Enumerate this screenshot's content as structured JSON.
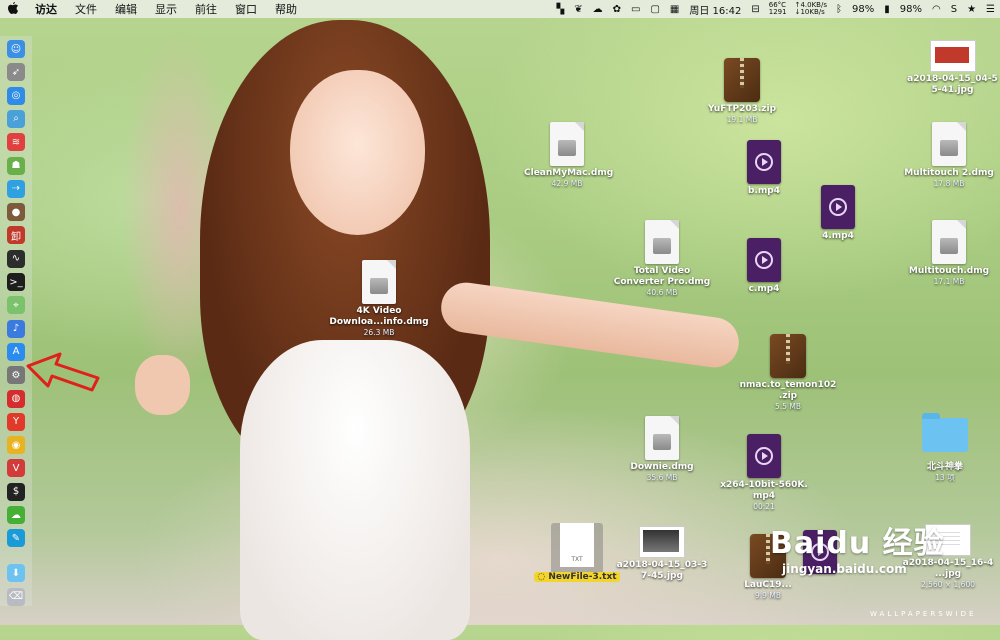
{
  "menubar": {
    "apple": "",
    "items": [
      "访达",
      "文件",
      "编辑",
      "显示",
      "前往",
      "窗口",
      "帮助"
    ],
    "status": {
      "clock": "周日 16:42",
      "temp": "66°C",
      "fan": "1291",
      "upload": "↑4.0KB/s",
      "download": "↓10KB/s",
      "battery1": "98%",
      "battery2": "98%"
    }
  },
  "dock": {
    "icons": [
      {
        "name": "finder-icon",
        "color": "#3b8fe5",
        "glyph": "☺"
      },
      {
        "name": "launchpad-icon",
        "color": "#8a8a8a",
        "glyph": "➶"
      },
      {
        "name": "safari-icon",
        "color": "#2e8ce6",
        "glyph": "◎"
      },
      {
        "name": "preview-icon",
        "color": "#4aa0d8",
        "glyph": "⌕"
      },
      {
        "name": "app-red-icon",
        "color": "#e04040",
        "glyph": "≋"
      },
      {
        "name": "android-icon",
        "color": "#69b04a",
        "glyph": "☗"
      },
      {
        "name": "migration-icon",
        "color": "#2fa0e0",
        "glyph": "⇢"
      },
      {
        "name": "brown-app-icon",
        "color": "#7d5a3b",
        "glyph": "●"
      },
      {
        "name": "red-app-icon",
        "color": "#c0392b",
        "glyph": "卸"
      },
      {
        "name": "activity-monitor-icon",
        "color": "#2d2d2d",
        "glyph": "∿"
      },
      {
        "name": "terminal-icon",
        "color": "#1e1e1e",
        "glyph": ">_"
      },
      {
        "name": "maps-icon",
        "color": "#7cc26d",
        "glyph": "⌖"
      },
      {
        "name": "siri-icon",
        "color": "#3b7be0",
        "glyph": "♪"
      },
      {
        "name": "app-store-icon",
        "color": "#2b8cf0",
        "glyph": "A"
      },
      {
        "name": "system-preferences-icon",
        "color": "#777777",
        "glyph": "⚙"
      },
      {
        "name": "netease-music-icon",
        "color": "#d42d2d",
        "glyph": "◍"
      },
      {
        "name": "yandex-icon",
        "color": "#e23a2a",
        "glyph": "Y"
      },
      {
        "name": "chrome-icon",
        "color": "#e8b320",
        "glyph": "◉"
      },
      {
        "name": "vivaldi-icon",
        "color": "#d33b3b",
        "glyph": "V"
      },
      {
        "name": "console-icon",
        "color": "#222222",
        "glyph": "$"
      },
      {
        "name": "wechat-icon",
        "color": "#45b035",
        "glyph": "☁"
      },
      {
        "name": "xcode-icon",
        "color": "#1a9ad6",
        "glyph": "✎"
      },
      {
        "name": "downloads-folder-icon",
        "color": "#6cc3f2",
        "glyph": "⬇"
      },
      {
        "name": "trash-icon",
        "color": "#b8bcc0",
        "glyph": "⌫"
      }
    ]
  },
  "desktop": {
    "files": [
      {
        "name": "YuFTP203.zip",
        "size": "19.1 MB"
      },
      {
        "name": "a2018-04-15_04-5 5-41.jpg",
        "size": ""
      },
      {
        "name": "CleanMyMac.dmg",
        "size": "42.9 MB"
      },
      {
        "name": "b.mp4",
        "size": ""
      },
      {
        "name": "Multitouch 2.dmg",
        "size": "17.8 MB"
      },
      {
        "name": "4.mp4",
        "size": ""
      },
      {
        "name": "Total Video Converter Pro.dmg",
        "size": "40.6 MB"
      },
      {
        "name": "c.mp4",
        "size": ""
      },
      {
        "name": "Multitouch.dmg",
        "size": "17.1 MB"
      },
      {
        "name": "4K Video Downloa...info.dmg",
        "size": "26.3 MB"
      },
      {
        "name": "nmac.to_temon102 .zip",
        "size": "5.5 MB"
      },
      {
        "name": "北斗神拳",
        "size": "13 项"
      },
      {
        "name": "Downie.dmg",
        "size": "35.6 MB"
      },
      {
        "name": "x264-10bit-560K. mp4",
        "size": "00:21"
      },
      {
        "name": "NewFile-3.txt",
        "size": ""
      },
      {
        "name": "a2018-04-15_03-3 7-45.jpg",
        "size": ""
      },
      {
        "name": "LauC19...",
        "size": "9.9 MB"
      },
      {
        "name": "a2018-04-15_16-4 ...jpg",
        "size": "2,560 × 1,600"
      }
    ],
    "txt_label": "TXT"
  },
  "watermark": {
    "brand": "Baidu 经验",
    "site": "jingyan.baidu.com",
    "credit": "WALLPAPERSWIDE"
  },
  "colors": {
    "arrow": "#e0201b",
    "rename_highlight": "#f2d42a"
  }
}
